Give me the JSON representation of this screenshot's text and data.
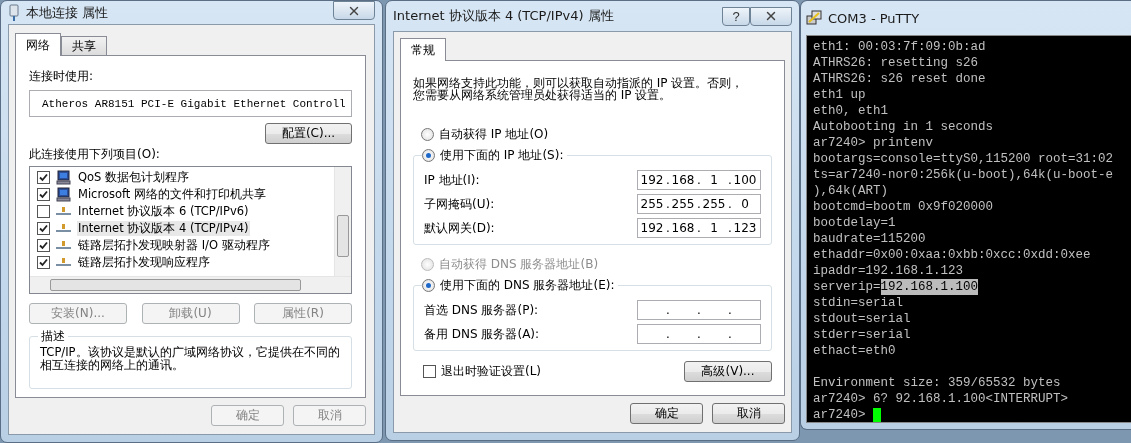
{
  "network_dialog": {
    "title": "本地连接 属性",
    "tabs": [
      {
        "label": "网络",
        "selected": true
      },
      {
        "label": "共享",
        "selected": false
      }
    ],
    "connect_using_label": "连接时使用:",
    "adapter": "Atheros AR8151 PCI-E Gigabit Ethernet Controll",
    "configure_button": "配置(C)...",
    "items_label": "此连接使用下列项目(O):",
    "items": [
      {
        "label": "QoS 数据包计划程序",
        "checked": true,
        "selected": false,
        "kind": "client"
      },
      {
        "label": "Microsoft 网络的文件和打印机共享",
        "checked": true,
        "selected": false,
        "kind": "client"
      },
      {
        "label": "Internet 协议版本 6 (TCP/IPv6)",
        "checked": false,
        "selected": false,
        "kind": "protocol"
      },
      {
        "label": "Internet 协议版本 4 (TCP/IPv4)",
        "checked": true,
        "selected": true,
        "kind": "protocol"
      },
      {
        "label": "链路层拓扑发现映射器 I/O 驱动程序",
        "checked": true,
        "selected": false,
        "kind": "protocol"
      },
      {
        "label": "链路层拓扑发现响应程序",
        "checked": true,
        "selected": false,
        "kind": "protocol"
      }
    ],
    "item_buttons": [
      {
        "label": "安装(N)...",
        "disabled": true
      },
      {
        "label": "卸载(U)",
        "disabled": true
      },
      {
        "label": "属性(R)",
        "disabled": true
      }
    ],
    "description_title": "描述",
    "description": "TCP/IP。该协议是默认的广域网络协议，它提供在不同的相互连接的网络上的通讯。",
    "footer_buttons": [
      {
        "label": "确定",
        "disabled": true
      },
      {
        "label": "取消",
        "disabled": true
      }
    ]
  },
  "ipv4_dialog": {
    "title": "Internet 协议版本 4 (TCP/IPv4) 属性",
    "help_button": "?",
    "tabs": [
      {
        "label": "常规",
        "selected": true
      }
    ],
    "intro": "如果网络支持此功能，则可以获取自动指派的 IP 设置。否则，您需要从网络系统管理员处获得适当的 IP 设置。",
    "separator": ".",
    "ip_options": [
      {
        "label": "自动获得 IP 地址(O)",
        "selected": false,
        "disabled": false
      },
      {
        "label": "使用下面的 IP 地址(S):",
        "selected": true,
        "disabled": false
      }
    ],
    "ip_fields": [
      {
        "label": "IP 地址(I):",
        "octets": [
          "192",
          "168",
          "1",
          "100"
        ]
      },
      {
        "label": "子网掩码(U):",
        "octets": [
          "255",
          "255",
          "255",
          "0"
        ]
      },
      {
        "label": "默认网关(D):",
        "octets": [
          "192",
          "168",
          "1",
          "123"
        ]
      }
    ],
    "dns_options": [
      {
        "label": "自动获得 DNS 服务器地址(B)",
        "selected": false,
        "disabled": true
      },
      {
        "label": "使用下面的 DNS 服务器地址(E):",
        "selected": true,
        "disabled": false
      }
    ],
    "dns_fields": [
      {
        "label": "首选 DNS 服务器(P):"
      },
      {
        "label": "备用 DNS 服务器(A):"
      }
    ],
    "validate_checkbox": {
      "label": "退出时验证设置(L)",
      "checked": false
    },
    "advanced_button": "高级(V)...",
    "footer_buttons": [
      {
        "label": "确定",
        "disabled": false
      },
      {
        "label": "取消",
        "disabled": false
      }
    ]
  },
  "putty": {
    "title": "COM3 - PuTTY",
    "lines": [
      {
        "text": "eth1: 00:03:7f:09:0b:ad"
      },
      {
        "text": "ATHRS26: resetting s26"
      },
      {
        "text": "ATHRS26: s26 reset done"
      },
      {
        "text": "eth1 up"
      },
      {
        "text": "eth0, eth1"
      },
      {
        "text": "Autobooting in 1 seconds"
      },
      {
        "text": "ar7240> printenv"
      },
      {
        "text": "bootargs=console=ttyS0,115200 root=31:02"
      },
      {
        "text": "ts=ar7240-nor0:256k(u-boot),64k(u-boot-e"
      },
      {
        "text": "),64k(ART)"
      },
      {
        "text": "bootcmd=bootm 0x9f020000"
      },
      {
        "text": "bootdelay=1"
      },
      {
        "text": "baudrate=115200"
      },
      {
        "text": "ethaddr=0x00:0xaa:0xbb:0xcc:0xdd:0xee"
      },
      {
        "text": "ipaddr=192.168.1.123"
      },
      {
        "text": "serverip=",
        "selection": "192.168.1.100"
      },
      {
        "text": "stdin=serial"
      },
      {
        "text": "stdout=serial"
      },
      {
        "text": "stderr=serial"
      },
      {
        "text": "ethact=eth0"
      },
      {
        "text": "Environment size: 359/65532 bytes",
        "gap_before": true
      },
      {
        "text": "ar7240> 6? 92.168.1.100<INTERRUPT>"
      },
      {
        "text": "ar7240> ",
        "cursor": true
      }
    ]
  }
}
